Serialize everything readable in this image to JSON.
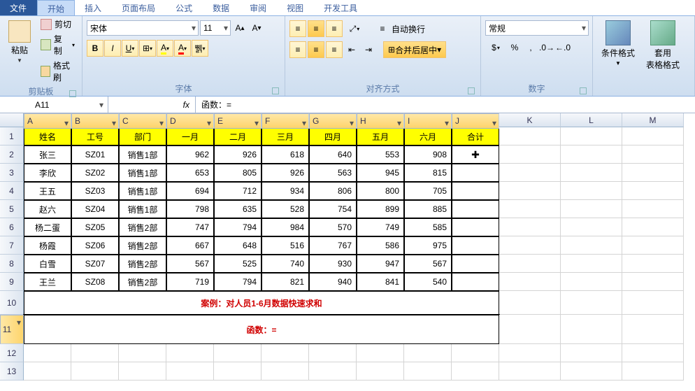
{
  "tabs": {
    "file": "文件",
    "items": [
      "开始",
      "插入",
      "页面布局",
      "公式",
      "数据",
      "审阅",
      "视图",
      "开发工具"
    ],
    "active_index": 0
  },
  "ribbon": {
    "clipboard": {
      "label": "剪贴板",
      "paste": "粘贴",
      "cut": "剪切",
      "copy": "复制",
      "painter": "格式刷"
    },
    "font": {
      "label": "字体",
      "name": "宋体",
      "size": "11"
    },
    "alignment": {
      "label": "对齐方式",
      "wrap": "自动换行",
      "merge": "合并后居中"
    },
    "number": {
      "label": "数字",
      "format": "常规"
    },
    "styles": {
      "cond": "条件格式",
      "table": "套用\n表格格式"
    }
  },
  "formula_bar": {
    "cell_ref": "A11",
    "fx_label": "fx",
    "content": "函数：="
  },
  "columns": [
    "A",
    "B",
    "C",
    "D",
    "E",
    "F",
    "G",
    "H",
    "I",
    "J",
    "K",
    "L",
    "M"
  ],
  "header_row": [
    "姓名",
    "工号",
    "部门",
    "一月",
    "二月",
    "三月",
    "四月",
    "五月",
    "六月",
    "合计"
  ],
  "data_rows": [
    [
      "张三",
      "SZ01",
      "销售1部",
      "962",
      "926",
      "618",
      "640",
      "553",
      "908",
      ""
    ],
    [
      "李欣",
      "SZ02",
      "销售1部",
      "653",
      "805",
      "926",
      "563",
      "945",
      "815",
      ""
    ],
    [
      "王五",
      "SZ03",
      "销售1部",
      "694",
      "712",
      "934",
      "806",
      "800",
      "705",
      ""
    ],
    [
      "赵六",
      "SZ04",
      "销售1部",
      "798",
      "635",
      "528",
      "754",
      "899",
      "885",
      ""
    ],
    [
      "杨二蛋",
      "SZ05",
      "销售2部",
      "747",
      "794",
      "984",
      "570",
      "749",
      "585",
      ""
    ],
    [
      "杨霞",
      "SZ06",
      "销售2部",
      "667",
      "648",
      "516",
      "767",
      "586",
      "975",
      ""
    ],
    [
      "白雪",
      "SZ07",
      "销售2部",
      "567",
      "525",
      "740",
      "930",
      "947",
      "567",
      ""
    ],
    [
      "王兰",
      "SZ08",
      "销售2部",
      "719",
      "794",
      "821",
      "940",
      "841",
      "540",
      ""
    ]
  ],
  "row10_text": "案例：对人员1-6月数据快速求和",
  "row11_text": "函数：=",
  "chart_data": {
    "type": "table",
    "title": "案例：对人员1-6月数据快速求和",
    "columns": [
      "姓名",
      "工号",
      "部门",
      "一月",
      "二月",
      "三月",
      "四月",
      "五月",
      "六月",
      "合计"
    ],
    "rows": [
      {
        "姓名": "张三",
        "工号": "SZ01",
        "部门": "销售1部",
        "一月": 962,
        "二月": 926,
        "三月": 618,
        "四月": 640,
        "五月": 553,
        "六月": 908,
        "合计": null
      },
      {
        "姓名": "李欣",
        "工号": "SZ02",
        "部门": "销售1部",
        "一月": 653,
        "二月": 805,
        "三月": 926,
        "四月": 563,
        "五月": 945,
        "六月": 815,
        "合计": null
      },
      {
        "姓名": "王五",
        "工号": "SZ03",
        "部门": "销售1部",
        "一月": 694,
        "二月": 712,
        "三月": 934,
        "四月": 806,
        "五月": 800,
        "六月": 705,
        "合计": null
      },
      {
        "姓名": "赵六",
        "工号": "SZ04",
        "部门": "销售1部",
        "一月": 798,
        "二月": 635,
        "三月": 528,
        "四月": 754,
        "五月": 899,
        "六月": 885,
        "合计": null
      },
      {
        "姓名": "杨二蛋",
        "工号": "SZ05",
        "部门": "销售2部",
        "一月": 747,
        "二月": 794,
        "三月": 984,
        "四月": 570,
        "五月": 749,
        "六月": 585,
        "合计": null
      },
      {
        "姓名": "杨霞",
        "工号": "SZ06",
        "部门": "销售2部",
        "一月": 667,
        "二月": 648,
        "三月": 516,
        "四月": 767,
        "五月": 586,
        "六月": 975,
        "合计": null
      },
      {
        "姓名": "白雪",
        "工号": "SZ07",
        "部门": "销售2部",
        "一月": 567,
        "二月": 525,
        "三月": 740,
        "四月": 930,
        "五月": 947,
        "六月": 567,
        "合计": null
      },
      {
        "姓名": "王兰",
        "工号": "SZ08",
        "部门": "销售2部",
        "一月": 719,
        "二月": 794,
        "三月": 821,
        "四月": 940,
        "五月": 841,
        "六月": 540,
        "合计": null
      }
    ]
  }
}
